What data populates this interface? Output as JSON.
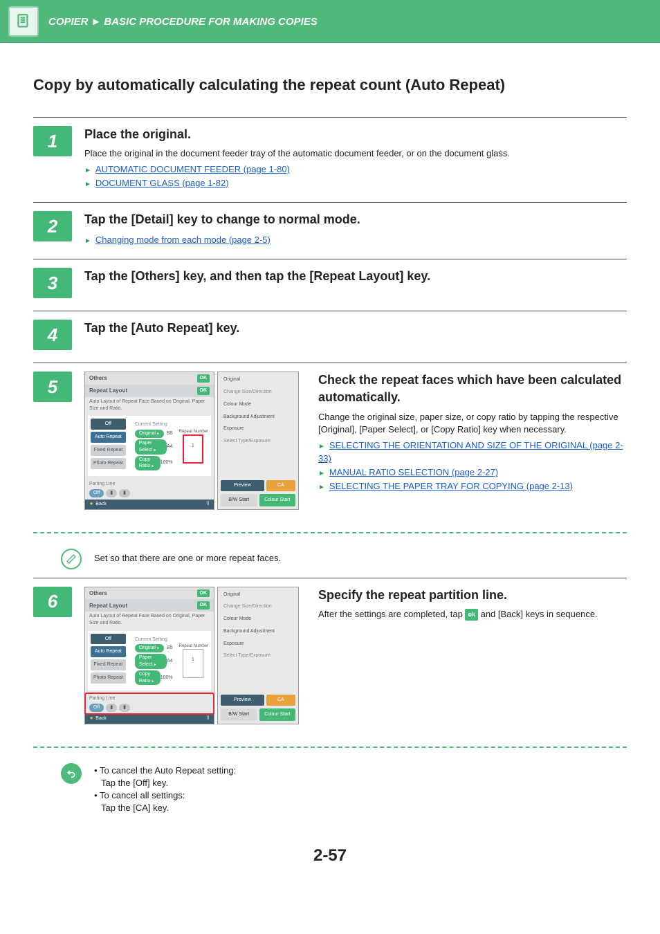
{
  "header": {
    "breadcrumb_a": "COPIER",
    "sep": "►",
    "breadcrumb_b": "BASIC PROCEDURE FOR MAKING COPIES"
  },
  "title": "Copy by automatically calculating the repeat count (Auto Repeat)",
  "steps": {
    "s1": {
      "num": "1",
      "title": "Place the original.",
      "desc": "Place the original in the document feeder tray of the automatic document feeder, or on the document glass.",
      "link1": "AUTOMATIC DOCUMENT FEEDER (page 1-80)",
      "link2": "DOCUMENT GLASS (page 1-82)"
    },
    "s2": {
      "num": "2",
      "title": "Tap the [Detail] key to change to normal mode.",
      "link1": "Changing mode from each mode (page 2-5)"
    },
    "s3": {
      "num": "3",
      "title": "Tap the [Others] key, and then tap the [Repeat Layout] key."
    },
    "s4": {
      "num": "4",
      "title": "Tap the [Auto Repeat] key."
    },
    "s5": {
      "num": "5",
      "title": "Check the repeat faces which have been calculated automatically.",
      "desc": "Change the original size, paper size, or copy ratio by tapping the respective [Original], [Paper Select], or [Copy Ratio] key when necessary.",
      "link1": "SELECTING THE ORIENTATION AND SIZE OF THE ORIGINAL (page 2-33)",
      "link2": "MANUAL RATIO SELECTION (page 2-27)",
      "link3": "SELECTING THE PAPER TRAY FOR COPYING (page 2-13)"
    },
    "s6": {
      "num": "6",
      "title": "Specify the repeat partition line.",
      "desc_a": "After the settings are completed, tap ",
      "desc_b": " and [Back] keys in sequence.",
      "ok": "ok"
    }
  },
  "note1": "Set so that there are one or more repeat faces.",
  "note2": {
    "a": "To cancel the Auto Repeat setting:",
    "a2": "Tap the [Off] key.",
    "b": "To cancel all settings:",
    "b2": "Tap the [CA] key."
  },
  "mock": {
    "top1": "Others",
    "top2": "Repeat Layout",
    "sub": "Auto Layout of Repeat Face Based on Original, Paper Size and Ratio.",
    "ok": "OK",
    "tabs": {
      "off": "Off",
      "auto": "Auto Repeat",
      "fixed": "Fixed Repeat",
      "photo": "Photo Repeat"
    },
    "curset": "Current Setting",
    "original": "Original",
    "original_v": "B5",
    "paper": "Paper Select",
    "paper_v": "A4",
    "ratio": "Copy Ratio",
    "ratio_v": "100%",
    "repeat_lbl": "Repeat Number",
    "repeat_v": "1",
    "parting": "Parting Line",
    "off": "Off",
    "back": "Back",
    "side": {
      "orig": "Original",
      "orig_sub": "Change Size/Direction",
      "colour": "Colour Mode",
      "bg": "Background Adjustment",
      "exp": "Exposure",
      "exp_sub": "Select Type/Exposure",
      "preview": "Preview",
      "ca": "CA",
      "bw": "B/W Start",
      "colstart": "Colour Start"
    }
  },
  "pagenum": "2-57"
}
